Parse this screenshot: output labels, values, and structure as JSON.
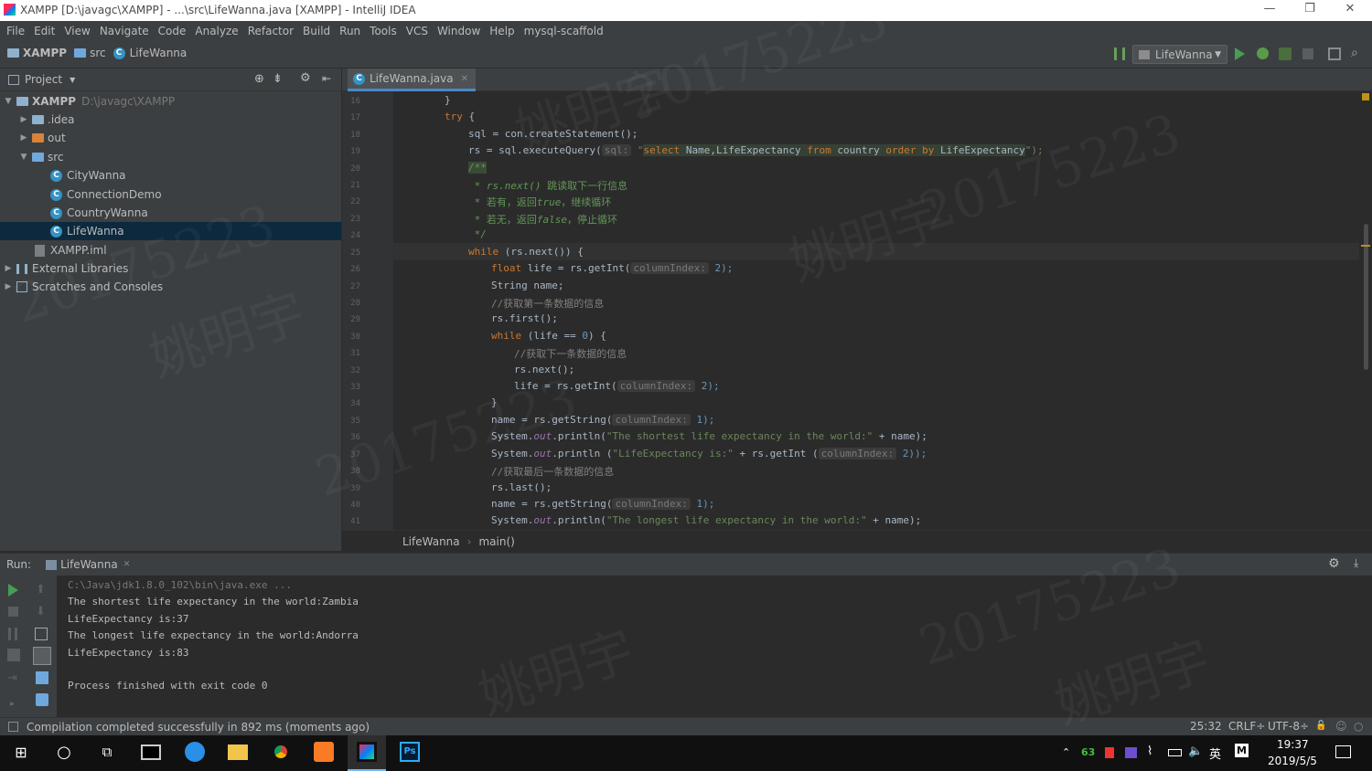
{
  "window": {
    "title": "XAMPP [D:\\javagc\\XAMPP] - ...\\src\\LifeWanna.java [XAMPP] - IntelliJ IDEA",
    "minimize": "—",
    "restore": "❐",
    "close": "✕"
  },
  "menu": [
    "File",
    "Edit",
    "View",
    "Navigate",
    "Code",
    "Analyze",
    "Refactor",
    "Build",
    "Run",
    "Tools",
    "VCS",
    "Window",
    "Help",
    "mysql-scaffold"
  ],
  "breadcrumb": {
    "project": "XAMPP",
    "folder": "src",
    "file": "LifeWanna"
  },
  "run_config": {
    "label": "LifeWanna"
  },
  "project_panel": {
    "title": "Project"
  },
  "tree": [
    {
      "label": "XAMPP",
      "path": "D:\\javagc\\XAMPP"
    },
    {
      "label": ".idea"
    },
    {
      "label": "out"
    },
    {
      "label": "src"
    },
    {
      "label": "CityWanna"
    },
    {
      "label": "ConnectionDemo"
    },
    {
      "label": "CountryWanna"
    },
    {
      "label": "LifeWanna"
    },
    {
      "label": "XAMPP.iml"
    },
    {
      "label": "External Libraries"
    },
    {
      "label": "Scratches and Consoles"
    }
  ],
  "editor": {
    "tab": "LifeWanna.java",
    "line_numbers": [
      "16",
      "17",
      "18",
      "19",
      "20",
      "21",
      "22",
      "23",
      "24",
      "25",
      "26",
      "27",
      "28",
      "29",
      "30",
      "31",
      "32",
      "33",
      "34",
      "35",
      "36",
      "37",
      "38",
      "39",
      "40",
      "41"
    ],
    "code": {
      "l16": "}",
      "l17_kw": "try",
      "l17_rest": " {",
      "l18": "sql = con.createStatement();",
      "l19_a": "rs = sql.executeQuery(",
      "l19_hint": "sql:",
      "l19_q": "\"",
      "l19_s1": "select",
      "l19_s2": " Name",
      "l19_s3": ",LifeExpectancy ",
      "l19_s4": "from",
      "l19_s5": " country ",
      "l19_s6": "order by",
      "l19_s7": " LifeExpectancy",
      "l19_end": "\");",
      "l20": "/**",
      "l21_a": " * ",
      "l21_b": "rs.next()",
      "l21_c": " 跳读取下一行信息",
      "l22_a": " * 若有，返回",
      "l22_b": "true",
      "l22_c": "，继续循环",
      "l23_a": " * 若无，返回",
      "l23_b": "false",
      "l23_c": "，停止循环",
      "l24": " */",
      "l25_kw": "while",
      "l25_rest": " (rs.next()) {",
      "l26_kw": "float",
      "l26_a": " life = rs.getInt(",
      "l26_hint": "columnIndex:",
      "l26_b": " 2);",
      "l27": "String name;",
      "l28": "//获取第一条数据的信息",
      "l29": "rs.first();",
      "l30_kw": "while",
      "l30_a": " (life == ",
      "l30_num": "0",
      "l30_b": ") {",
      "l31": "//获取下一条数据的信息",
      "l32": "rs.next();",
      "l33_a": "life = rs.getInt(",
      "l33_hint": "columnIndex:",
      "l33_b": " 2);",
      "l34": "}",
      "l35_a": "name = rs.getString(",
      "l35_hint": "columnIndex:",
      "l35_b": " 1);",
      "l36_a": "System.",
      "l36_out": "out",
      "l36_b": ".println(",
      "l36_str": "\"The shortest life expectancy in the world:\"",
      "l36_c": " + name);",
      "l37_a": "System.",
      "l37_out": "out",
      "l37_b": ".println (",
      "l37_str": "\"LifeExpectancy is:\"",
      "l37_c": " + rs.getInt (",
      "l37_hint": "columnIndex:",
      "l37_d": " 2));",
      "l38": "//获取最后一条数据的信息",
      "l39": "rs.last();",
      "l40_a": "name = rs.getString(",
      "l40_hint": "columnIndex:",
      "l40_b": " 1);",
      "l41_a": "System.",
      "l41_out": "out",
      "l41_b": ".println(",
      "l41_str": "\"The longest life expectancy in the world:\"",
      "l41_c": " + name);"
    },
    "breadcrumb": {
      "cls": "LifeWanna",
      "method": "main()"
    }
  },
  "run": {
    "label": "Run:",
    "tab": "LifeWanna",
    "output": [
      "C:\\Java\\jdk1.8.0_102\\bin\\java.exe ...",
      "The shortest life expectancy in the world:Zambia",
      "LifeExpectancy is:37",
      "The longest life expectancy in the world:Andorra",
      "LifeExpectancy is:83",
      "",
      "Process finished with exit code 0"
    ]
  },
  "status": {
    "message": "Compilation completed successfully in 892 ms (moments ago)",
    "position": "25:32",
    "line_sep": "CRLF÷",
    "encoding": "UTF-8÷"
  },
  "taskbar": {
    "time": "19:37",
    "date": "2019/5/5",
    "ime": "英",
    "tray_num": "63"
  },
  "watermark": {
    "text": "20175223",
    "name": "姚明宇"
  },
  "colors": {
    "bg": "#2b2b2b",
    "panel": "#3c3f41",
    "keyword": "#cc7832",
    "string": "#6a8759",
    "comment": "#808080",
    "selection": "#0d293e",
    "accent": "#4a88c7"
  }
}
